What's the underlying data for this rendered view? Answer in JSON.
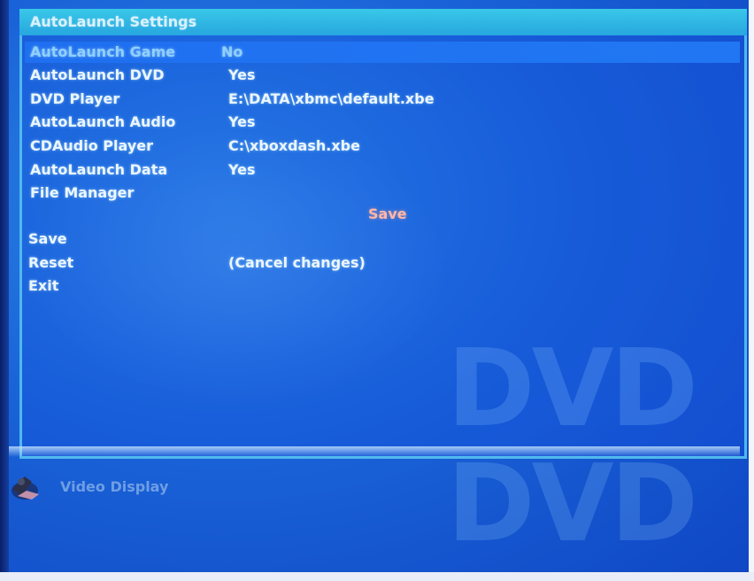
{
  "dialog": {
    "title": "AutoLaunch Settings"
  },
  "settings": [
    {
      "label": "AutoLaunch Game",
      "value": "No"
    },
    {
      "label": "AutoLaunch DVD",
      "value": "Yes"
    },
    {
      "label": "DVD Player",
      "value": "E:\\DATA\\xbmc\\default.xbe"
    },
    {
      "label": "AutoLaunch Audio",
      "value": "Yes"
    },
    {
      "label": "CDAudio Player",
      "value": "C:\\xboxdash.xbe"
    },
    {
      "label": "AutoLaunch Data",
      "value": "Yes"
    },
    {
      "label": "File Manager",
      "value": ""
    }
  ],
  "save_section": {
    "heading": "Save",
    "actions": {
      "save": "Save",
      "reset": "Reset",
      "exit": "Exit"
    },
    "reset_note": "(Cancel changes)"
  },
  "background": {
    "logo_text": "DVD"
  },
  "bottom_menu": {
    "item_label": "Video Display",
    "item_icon": "video-display-icon"
  },
  "colors": {
    "background": "#1a63d8",
    "header": "#2fb6e3",
    "highlight_row": "#1f6ff0",
    "highlight_text": "#8fd0ff",
    "save_heading": "#ffb7a8"
  }
}
